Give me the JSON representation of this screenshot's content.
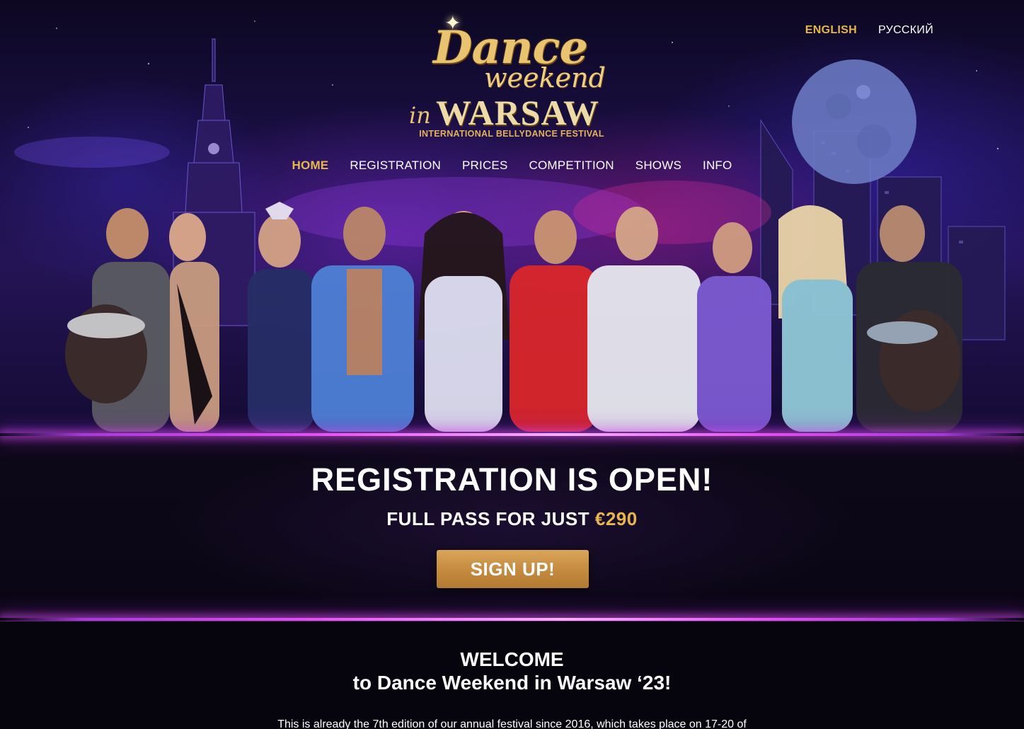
{
  "header": {
    "languages": [
      {
        "label": "ENGLISH",
        "active": true
      },
      {
        "label": "РУССКИЙ",
        "active": false
      }
    ],
    "logo": {
      "line1": "Dance",
      "line2": "weekend",
      "line3a": "in",
      "line3b": "WARSAW",
      "tagline": "INTERNATIONAL BELLYDANCE FESTIVAL"
    },
    "nav": [
      {
        "label": "HOME",
        "active": true
      },
      {
        "label": "REGISTRATION",
        "active": false
      },
      {
        "label": "PRICES",
        "active": false
      },
      {
        "label": "COMPETITION",
        "active": false
      },
      {
        "label": "SHOWS",
        "active": false
      },
      {
        "label": "INFO",
        "active": false
      }
    ]
  },
  "promo": {
    "title": "REGISTRATION IS OPEN!",
    "subtitle_prefix": "FULL PASS FOR JUST",
    "price": "€290",
    "cta_label": "SIGN UP!"
  },
  "welcome": {
    "line1": "WELCOME",
    "line2": "to Dance Weekend in Warsaw ‘23!",
    "intro": "This is already the 7th edition of our annual festival since 2016, which takes place on 17-20 of"
  },
  "colors": {
    "accent_gold": "#e8b64f",
    "button_gold": "#c48a3f",
    "glow_magenta": "#e24ff0",
    "background": "#07040f"
  },
  "icons": {
    "logo_star": "sparkle-star-icon"
  }
}
